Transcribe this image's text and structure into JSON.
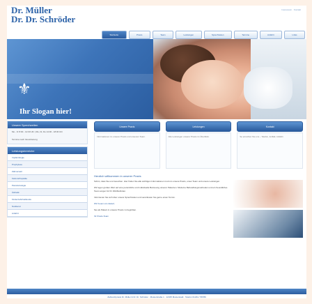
{
  "logo": {
    "line1": "Dr. Müller",
    "line2": "Dr. Dr. Schröder"
  },
  "top_right": "Impressum · Kontakt",
  "top_nav": [
    "Startseite",
    "Praxis",
    "Team",
    "Leistungen",
    "Sprechzeiten",
    "Termine",
    "Anfahrt",
    "Links"
  ],
  "hero": {
    "slogan": "Ihr Slogan hier!",
    "logo_glyph": "⚜"
  },
  "left": {
    "box1_head": "Unsere Sprechzeiten",
    "box1_text": "Mo - Fr 8:00 - 12:00 Uhr | Mo, Di, Do 14:00 - 18:00 Uhr",
    "box2_text": "Termine nach Vereinbarung",
    "nav_head": "Leistungsbereiche",
    "nav_items": [
      "Implantologie",
      "Prophylaxe",
      "Zahnersatz",
      "Kieferorthopädie",
      "Parodontologie",
      "Ästhetik",
      "Kinderzahnheilkunde",
      "Notdienst",
      "Anfahrt"
    ]
  },
  "main": {
    "buttons": [
      "Unsere Praxis",
      "Leistungen",
      "Kontakt"
    ],
    "cards": [
      "Informationen zu unserer Praxis und unserem Team.",
      "Alle Leistungen unserer Praxis im Überblick.",
      "So erreichen Sie uns – Telefon, E-Mail, Anfahrt."
    ],
    "welcome": "Herzlich willkommen in unserer Praxis",
    "paragraphs": [
      "Schön, dass Sie uns besuchen. Hier finden Sie alle wichtigen Informationen rund um unsere Praxis, unser Team und unsere Leistungen.",
      "Wir legen großen Wert auf eine persönliche und individuelle Betreuung unserer Patienten. Moderne Behandlungsmethoden und ein freundliches Team sorgen für Ihr Wohlbefinden.",
      "Informieren Sie sich über unsere Sprechzeiten und vereinbaren Sie gerne einen Termin."
    ],
    "greeting": "Wir freuen uns darauf,",
    "signoff": "Sie als Patient in unserer Praxis zu begrüßen.",
    "team": "Ihr Praxis-Team"
  },
  "footer": "Zahnarztpraxis Dr. Müller & Dr. Dr. Schröder · Musterstraße 1 · 12345 Musterstadt · Telefon 01234 / 56789"
}
